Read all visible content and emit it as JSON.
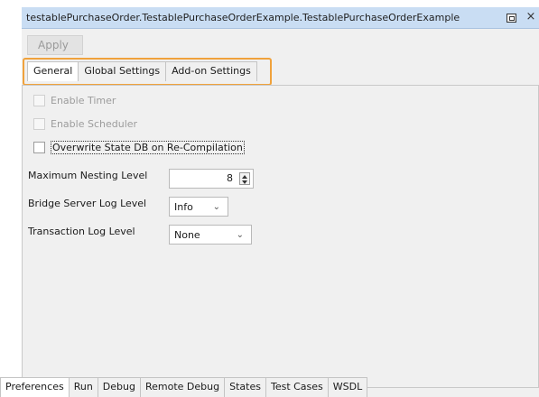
{
  "window": {
    "title": "testablePurchaseOrder.TestablePurchaseOrderExample.TestablePurchaseOrderExample",
    "restore_icon": "restore-window-icon",
    "close_icon": "close-icon",
    "close_glyph": "×"
  },
  "toolbar": {
    "apply_label": "Apply"
  },
  "tabs_top": [
    {
      "label": "General",
      "active": true
    },
    {
      "label": "Global Settings",
      "active": false
    },
    {
      "label": "Add-on Settings",
      "active": false
    }
  ],
  "general": {
    "enable_timer": {
      "label": "Enable Timer",
      "checked": false,
      "enabled": false
    },
    "enable_scheduler": {
      "label": "Enable Scheduler",
      "checked": false,
      "enabled": false
    },
    "overwrite_state_db": {
      "label": "Overwrite State DB on Re-Compilation",
      "checked": false,
      "enabled": true
    },
    "max_nesting_level": {
      "label": "Maximum Nesting Level",
      "value": "8"
    },
    "bridge_server_log_level": {
      "label": "Bridge Server Log Level",
      "value": "Info"
    },
    "transaction_log_level": {
      "label": "Transaction Log Level",
      "value": "None"
    }
  },
  "tabs_bottom": [
    {
      "label": "Preferences",
      "active": true
    },
    {
      "label": "Run",
      "active": false
    },
    {
      "label": "Debug",
      "active": false
    },
    {
      "label": "Remote Debug",
      "active": false
    },
    {
      "label": "States",
      "active": false
    },
    {
      "label": "Test Cases",
      "active": false
    },
    {
      "label": "WSDL",
      "active": false
    }
  ],
  "colors": {
    "titlebar": "#c9ddf3",
    "panel": "#f0f0f0",
    "tab_highlight": "#f0a23c"
  }
}
